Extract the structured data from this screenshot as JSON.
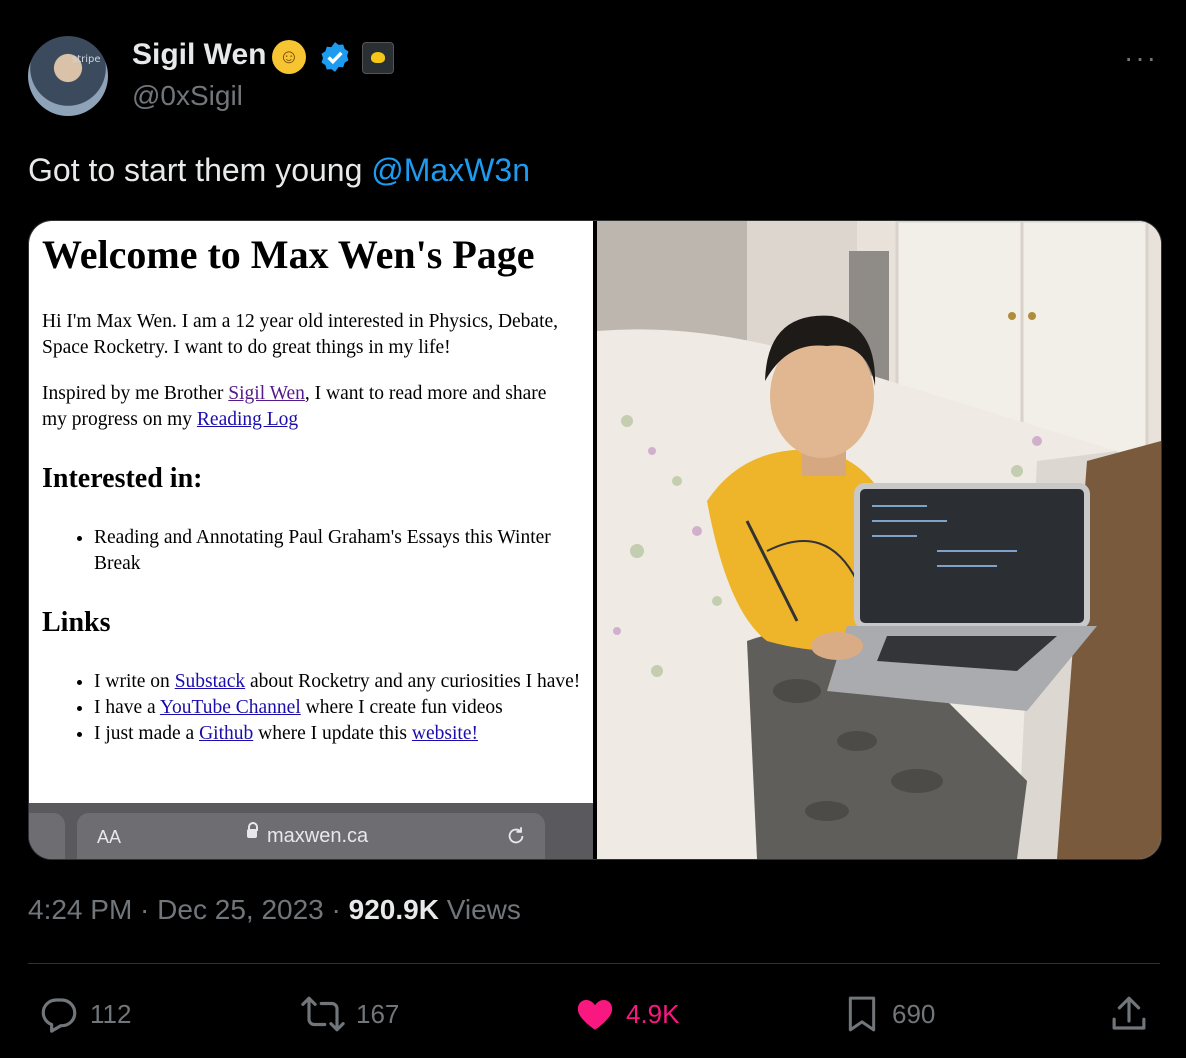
{
  "author": {
    "name": "Sigil Wen",
    "handle": "@0xSigil",
    "avatar_label": "stripe",
    "badges": [
      "cat-emoji-icon",
      "verified-icon",
      "affiliate-badge-icon"
    ]
  },
  "tweet": {
    "text": "Got to start them young ",
    "mention": "@MaxW3n"
  },
  "media": {
    "screenshot": {
      "title": "Welcome to Max Wen's Page",
      "intro": "Hi I'm Max Wen. I am a 12 year old interested in Physics, Debate, Space Rocketry. I want to do great things in my life!",
      "inspired_prefix": "Inspired by me Brother ",
      "inspired_link": "Sigil Wen",
      "inspired_middle": ", I want to read more and share my progress on my ",
      "reading_log_link": "Reading Log",
      "interested_heading": "Interested in:",
      "interested_items": [
        "Reading and Annotating Paul Graham's Essays this Winter Break"
      ],
      "links_heading": "Links",
      "link1_prefix": "I write on ",
      "link1_link": "Substack",
      "link1_suffix": " about Rocketry and any curiosities I have!",
      "link2_prefix": "I have a ",
      "link2_link": "YouTube Channel",
      "link2_suffix": " where I create fun videos",
      "link3_prefix": "I just made a ",
      "link3_link": "Github",
      "link3_middle": " where I update this ",
      "link3_link2": "website!",
      "browser": {
        "aa": "AA",
        "url": "maxwen.ca"
      }
    }
  },
  "meta": {
    "time": "4:24 PM",
    "date": "Dec 25, 2023",
    "views_count": "920.9K",
    "views_label": " Views"
  },
  "actions": {
    "replies": "112",
    "reposts": "167",
    "likes": "4.9K",
    "bookmarks": "690"
  },
  "colors": {
    "accent": "#1d9bf0",
    "like": "#f91880",
    "muted": "#71767b"
  }
}
